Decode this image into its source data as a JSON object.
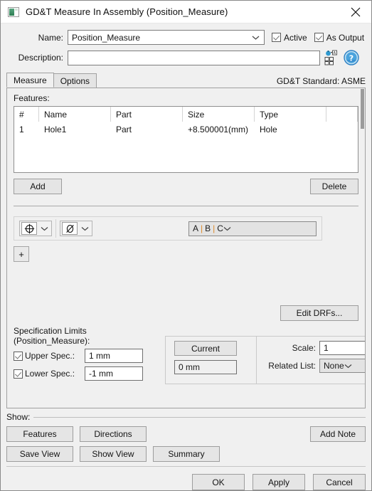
{
  "window": {
    "title": "GD&T Measure In Assembly (Position_Measure)",
    "app_icon": "window-icon",
    "close_icon": "close-icon"
  },
  "header": {
    "name_label": "Name:",
    "name_value": "Position_Measure",
    "description_label": "Description:",
    "description_value": "",
    "active_label": "Active",
    "active_checked": true,
    "as_output_label": "As Output",
    "as_output_checked": true,
    "attributes_icon": "attributes-icon",
    "help_icon": "help-icon"
  },
  "tabs": [
    {
      "label": "Measure",
      "active": true
    },
    {
      "label": "Options",
      "active": false
    }
  ],
  "standard_label": "GD&T Standard: ASME",
  "features": {
    "section_label": "Features:",
    "columns": [
      "#",
      "Name",
      "Part",
      "Size",
      "Type",
      ""
    ],
    "rows": [
      {
        "num": "1",
        "name": "Hole1",
        "part": "Part",
        "size": "+8.500001(mm)",
        "type": "Hole",
        "extra": ""
      }
    ],
    "add_label": "Add",
    "delete_label": "Delete"
  },
  "fcf": {
    "geometric_symbol": "position-symbol",
    "material_symbol": "diameter-symbol",
    "datum_reference": {
      "a": "A",
      "b": "B",
      "c": "C",
      "sep": "|"
    },
    "add_row_label": "+",
    "edit_drfs_label": "Edit DRFs..."
  },
  "spec": {
    "title": "Specification Limits (Position_Measure):",
    "upper_label": "Upper Spec.:",
    "upper_checked": true,
    "upper_value": "1 mm",
    "lower_label": "Lower Spec.:",
    "lower_checked": true,
    "lower_value": "-1 mm",
    "current_label": "Current",
    "current_value": "0 mm",
    "scale_label": "Scale:",
    "scale_value": "1",
    "related_list_label": "Related List:",
    "related_list_value": "None"
  },
  "show": {
    "legend": "Show:",
    "features_label": "Features",
    "directions_label": "Directions",
    "add_note_label": "Add Note",
    "save_view_label": "Save View",
    "show_view_label": "Show View",
    "summary_label": "Summary"
  },
  "footer": {
    "ok_label": "OK",
    "apply_label": "Apply",
    "cancel_label": "Cancel"
  },
  "colors": {
    "dialog_bg": "#f0f0f0",
    "titlebar_bg": "#ffffff",
    "field_bg": "#ffffff",
    "button_bg": "#e5e5e5",
    "border": "#8a8a8a",
    "datum_separator": "#e08a28",
    "accent_icon": "#2b7fc4"
  }
}
